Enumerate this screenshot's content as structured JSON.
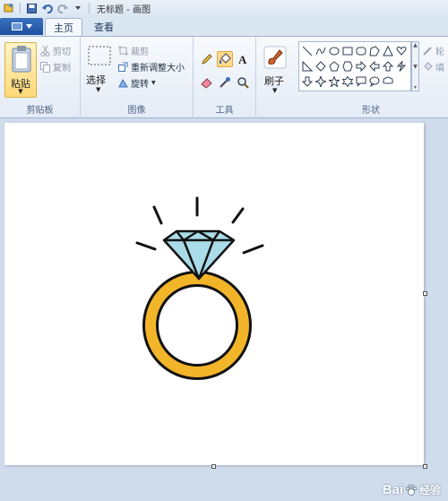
{
  "app": {
    "window_title": "无标题 - 画图"
  },
  "tabs": [
    {
      "label": "主页",
      "active": true
    },
    {
      "label": "查看",
      "active": false
    }
  ],
  "ribbon": {
    "clipboard": {
      "paste_label": "粘贴",
      "cut_label": "剪切",
      "copy_label": "复制",
      "group_label": "剪贴板"
    },
    "image": {
      "select_label": "选择",
      "crop_label": "裁剪",
      "resize_label": "重新调整大小",
      "rotate_label": "旋转",
      "group_label": "图像"
    },
    "tools": {
      "group_label": "工具",
      "active_tool": "fill-icon",
      "items": [
        "pencil-icon",
        "fill-icon",
        "text-icon",
        "eraser-icon",
        "color-picker-icon",
        "magnifier-icon"
      ]
    },
    "brushes": {
      "label": "刷子"
    },
    "shapes": {
      "group_label": "形状",
      "outline_label": "轮",
      "fill_label": "填"
    }
  },
  "colors": {
    "accent": "#1d4f9e",
    "ring_gold": "#f2b529",
    "diamond_blue": "#a9dbe8",
    "active_tool": "#fcd98d"
  },
  "watermark": {
    "text": "Bai",
    "suffix": "经验",
    "url_fragment": "jingyan.baidu.com"
  }
}
